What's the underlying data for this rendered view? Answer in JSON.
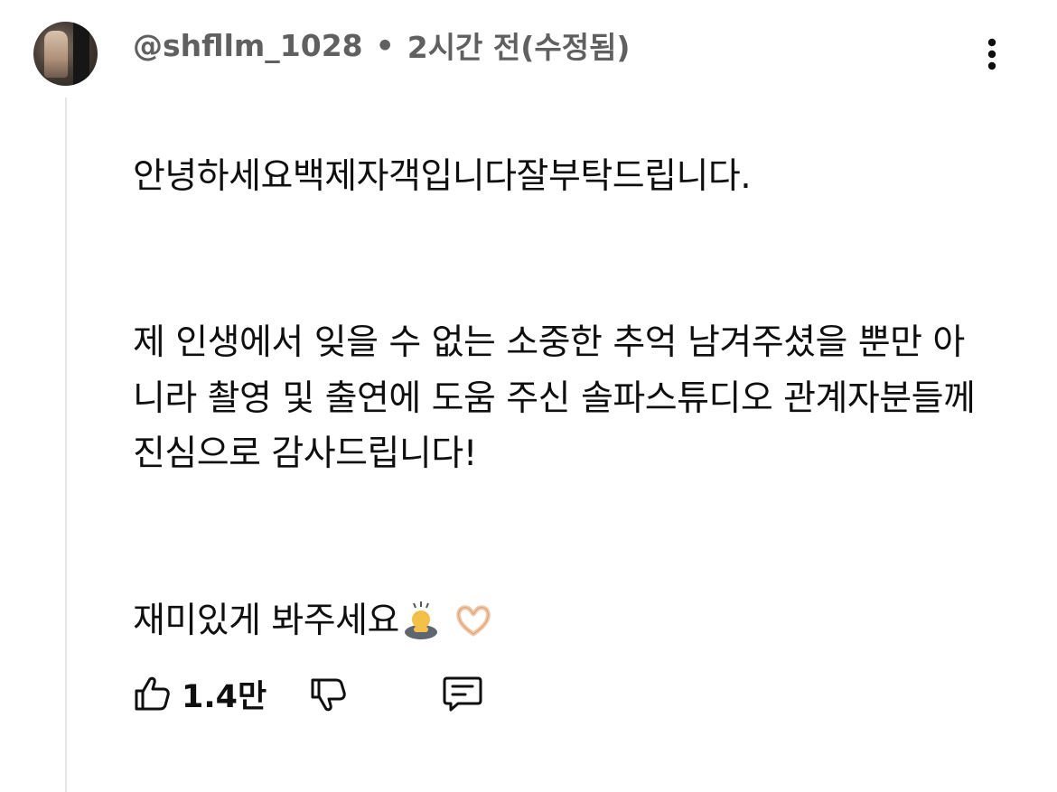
{
  "comment": {
    "author_handle": "@shfllm_1028",
    "separator": "•",
    "timestamp": "2시간 전(수정됨)",
    "paragraphs": [
      "안녕하세요백제자객입니다잘부탁드립니다.",
      "제 인생에서 잊을 수 없는 소중한 추억 남겨주셨을 뿐만 아니라 촬영 및 출연에 도움 주신 솔파스튜디오 관계자분들께 진심으로 감사드립니다!",
      "재미있게 봐주세요"
    ],
    "emojis": [
      "bowing-person-emoji",
      "heart-hands-emoji"
    ]
  },
  "actions": {
    "like_count": "1.4만",
    "icons": {
      "like": "thumbs-up-icon",
      "dislike": "thumbs-down-icon",
      "reply": "reply-comment-icon",
      "more": "more-vertical-icon"
    }
  },
  "colors": {
    "meta_text": "#606060",
    "body_text": "#0f0f0f",
    "thread_line": "#e6e6e6",
    "background": "#ffffff"
  }
}
